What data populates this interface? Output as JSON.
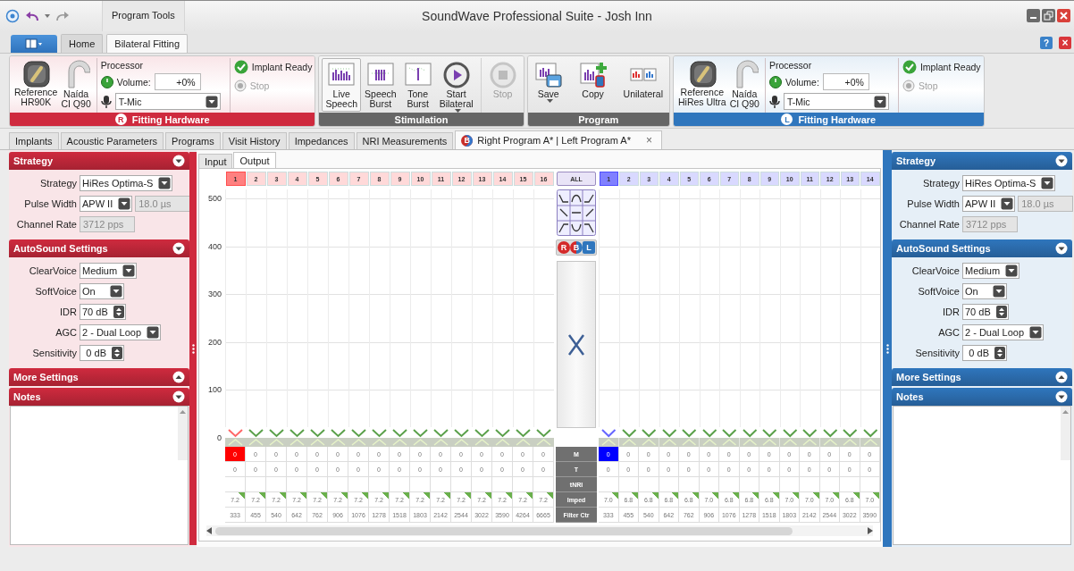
{
  "window": {
    "title": "SoundWave Professional Suite - Josh Inn",
    "contextual_tab": "Program Tools",
    "help": "?",
    "close": "×"
  },
  "ribbon_tabs": [
    {
      "label": "Home",
      "selected": false
    },
    {
      "label": "Bilateral Fitting",
      "selected": true
    }
  ],
  "ribbon_groups": [
    {
      "kind": "hardware",
      "color": "#cf2a3e",
      "title": "Fitting Hardware",
      "badge": "R",
      "devices": [
        "Reference\nHR90K",
        "Naída\nCI Q90"
      ],
      "processor": "Processor",
      "volume_label": "Volume:",
      "volume": "+0%",
      "input": "T-Mic",
      "status": "Implant Ready",
      "stop": {
        "label": "Stop",
        "disabled": true
      }
    },
    {
      "kind": "commands",
      "title": "Stimulation",
      "buttons": [
        {
          "label": "Live\nSpeech",
          "pressed": true,
          "disabled": false,
          "menu": false
        },
        {
          "label": "Speech\nBurst",
          "pressed": false,
          "disabled": false,
          "menu": false
        },
        {
          "label": "Tone\nBurst",
          "pressed": false,
          "disabled": false,
          "menu": false
        },
        {
          "label": "Start\nBilateral",
          "pressed": false,
          "disabled": false,
          "menu": true
        },
        {
          "label": "Stop",
          "pressed": false,
          "disabled": true,
          "menu": false
        }
      ]
    },
    {
      "kind": "commands",
      "title": "Program",
      "buttons": [
        {
          "label": "Save",
          "pressed": false,
          "disabled": false,
          "menu": true
        },
        {
          "label": "Copy",
          "pressed": false,
          "disabled": false,
          "menu": false
        },
        {
          "label": "Unilateral",
          "pressed": false,
          "disabled": false,
          "menu": false
        }
      ]
    },
    {
      "kind": "hardware",
      "color": "#2f76bd",
      "title": "Fitting Hardware",
      "badge": "L",
      "devices": [
        "Reference\nHiRes Ultra",
        "Naída\nCI Q90"
      ],
      "processor": "Processor",
      "volume_label": "Volume:",
      "volume": "+0%",
      "input": "T-Mic",
      "status": "Implant Ready",
      "stop": {
        "label": "Stop",
        "disabled": true
      }
    }
  ],
  "doc_tabs": [
    {
      "label": "Implants",
      "selected": false
    },
    {
      "label": "Acoustic Parameters",
      "selected": false
    },
    {
      "label": "Programs",
      "selected": false
    },
    {
      "label": "Visit History",
      "selected": false
    },
    {
      "label": "Impedances",
      "selected": false
    },
    {
      "label": "NRI Measurements",
      "selected": false
    },
    {
      "label": "Right Program A* | Left Program A*",
      "selected": true,
      "badge": "B",
      "close": "×"
    }
  ],
  "side_panels": [
    {
      "color": "#cf2a3e",
      "sections": [
        {
          "title": "Strategy",
          "expanded": true,
          "fields": [
            {
              "kind": "dropdown",
              "label": "Strategy",
              "value": "HiRes Optima-S"
            },
            {
              "kind": "dropdown",
              "label": "Pulse Width",
              "value": "APW II",
              "extra": "18.0 µs"
            },
            {
              "kind": "readonly",
              "label": "Channel Rate",
              "value": "3712 pps"
            }
          ]
        },
        {
          "title": "AutoSound Settings",
          "expanded": true,
          "fields": [
            {
              "kind": "dropdown",
              "label": "ClearVoice",
              "value": "Medium"
            },
            {
              "kind": "dropdown",
              "label": "SoftVoice",
              "value": "On"
            },
            {
              "kind": "spinner",
              "label": "IDR",
              "value": "70 dB"
            },
            {
              "kind": "dropdown",
              "label": "AGC",
              "value": "2 - Dual Loop"
            },
            {
              "kind": "spinner",
              "label": "Sensitivity",
              "value": "0 dB"
            }
          ]
        },
        {
          "title": "More Settings",
          "expanded": false
        },
        {
          "title": "Notes",
          "expanded": true,
          "kind": "notes"
        }
      ]
    },
    {
      "color": "#2f76bd",
      "sections": [
        {
          "title": "Strategy",
          "expanded": true,
          "fields": [
            {
              "kind": "dropdown",
              "label": "Strategy",
              "value": "HiRes Optima-S"
            },
            {
              "kind": "dropdown",
              "label": "Pulse Width",
              "value": "APW II",
              "extra": "18.0 µs"
            },
            {
              "kind": "readonly",
              "label": "Channel Rate",
              "value": "3712 pps"
            }
          ]
        },
        {
          "title": "AutoSound Settings",
          "expanded": true,
          "fields": [
            {
              "kind": "dropdown",
              "label": "ClearVoice",
              "value": "Medium"
            },
            {
              "kind": "dropdown",
              "label": "SoftVoice",
              "value": "On"
            },
            {
              "kind": "spinner",
              "label": "IDR",
              "value": "70 dB"
            },
            {
              "kind": "dropdown",
              "label": "AGC",
              "value": "2 - Dual Loop"
            },
            {
              "kind": "spinner",
              "label": "Sensitivity",
              "value": "0 dB"
            }
          ]
        },
        {
          "title": "More Settings",
          "expanded": false
        },
        {
          "title": "Notes",
          "expanded": true,
          "kind": "notes"
        }
      ]
    }
  ],
  "fitting": {
    "view_tabs": [
      {
        "label": "Input",
        "selected": false
      },
      {
        "label": "Output",
        "selected": true
      }
    ],
    "y_ticks": [
      "500",
      "400",
      "300",
      "200",
      "100",
      "0"
    ],
    "all_button": "ALL",
    "ear_buttons": [
      "R",
      "B",
      "L"
    ],
    "row_labels": [
      "M",
      "T",
      "tNRI",
      "Imped",
      "Filter Ctr"
    ],
    "grids": [
      {
        "color": "#ff0000",
        "channels": [
          {
            "label": "1",
            "selected": true,
            "m": "0",
            "t": "0",
            "imped": "7.2",
            "filter": "333"
          },
          {
            "label": "2",
            "selected": false,
            "m": "0",
            "t": "0",
            "imped": "7.2",
            "filter": "455"
          },
          {
            "label": "3",
            "selected": false,
            "m": "0",
            "t": "0",
            "imped": "7.2",
            "filter": "540"
          },
          {
            "label": "4",
            "selected": false,
            "m": "0",
            "t": "0",
            "imped": "7.2",
            "filter": "642"
          },
          {
            "label": "5",
            "selected": false,
            "m": "0",
            "t": "0",
            "imped": "7.2",
            "filter": "762"
          },
          {
            "label": "6",
            "selected": false,
            "m": "0",
            "t": "0",
            "imped": "7.2",
            "filter": "906"
          },
          {
            "label": "7",
            "selected": false,
            "m": "0",
            "t": "0",
            "imped": "7.2",
            "filter": "1076"
          },
          {
            "label": "8",
            "selected": false,
            "m": "0",
            "t": "0",
            "imped": "7.2",
            "filter": "1278"
          },
          {
            "label": "9",
            "selected": false,
            "m": "0",
            "t": "0",
            "imped": "7.2",
            "filter": "1518"
          },
          {
            "label": "10",
            "selected": false,
            "m": "0",
            "t": "0",
            "imped": "7.2",
            "filter": "1803"
          },
          {
            "label": "11",
            "selected": false,
            "m": "0",
            "t": "0",
            "imped": "7.2",
            "filter": "2142"
          },
          {
            "label": "12",
            "selected": false,
            "m": "0",
            "t": "0",
            "imped": "7.2",
            "filter": "2544"
          },
          {
            "label": "13",
            "selected": false,
            "m": "0",
            "t": "0",
            "imped": "7.2",
            "filter": "3022"
          },
          {
            "label": "14",
            "selected": false,
            "m": "0",
            "t": "0",
            "imped": "7.2",
            "filter": "3590"
          },
          {
            "label": "15",
            "selected": false,
            "m": "0",
            "t": "0",
            "imped": "7.2",
            "filter": "4264"
          },
          {
            "label": "16",
            "selected": false,
            "m": "0",
            "t": "0",
            "imped": "7.2",
            "filter": "6665"
          }
        ]
      },
      {
        "color": "#0000ff",
        "channels": [
          {
            "label": "1",
            "selected": true,
            "m": "0",
            "t": "0",
            "imped": "7.0",
            "filter": "333"
          },
          {
            "label": "2",
            "selected": false,
            "m": "0",
            "t": "0",
            "imped": "6.8",
            "filter": "455"
          },
          {
            "label": "3",
            "selected": false,
            "m": "0",
            "t": "0",
            "imped": "6.8",
            "filter": "540"
          },
          {
            "label": "4",
            "selected": false,
            "m": "0",
            "t": "0",
            "imped": "6.8",
            "filter": "642"
          },
          {
            "label": "5",
            "selected": false,
            "m": "0",
            "t": "0",
            "imped": "6.8",
            "filter": "762"
          },
          {
            "label": "6",
            "selected": false,
            "m": "0",
            "t": "0",
            "imped": "7.0",
            "filter": "906"
          },
          {
            "label": "7",
            "selected": false,
            "m": "0",
            "t": "0",
            "imped": "6.8",
            "filter": "1076"
          },
          {
            "label": "8",
            "selected": false,
            "m": "0",
            "t": "0",
            "imped": "6.8",
            "filter": "1278"
          },
          {
            "label": "9",
            "selected": false,
            "m": "0",
            "t": "0",
            "imped": "6.8",
            "filter": "1518"
          },
          {
            "label": "10",
            "selected": false,
            "m": "0",
            "t": "0",
            "imped": "7.0",
            "filter": "1803"
          },
          {
            "label": "11",
            "selected": false,
            "m": "0",
            "t": "0",
            "imped": "7.0",
            "filter": "2142"
          },
          {
            "label": "12",
            "selected": false,
            "m": "0",
            "t": "0",
            "imped": "7.0",
            "filter": "2544"
          },
          {
            "label": "13",
            "selected": false,
            "m": "0",
            "t": "0",
            "imped": "6.8",
            "filter": "3022"
          },
          {
            "label": "14",
            "selected": false,
            "m": "0",
            "t": "0",
            "imped": "7.0",
            "filter": "3590"
          }
        ]
      }
    ]
  }
}
